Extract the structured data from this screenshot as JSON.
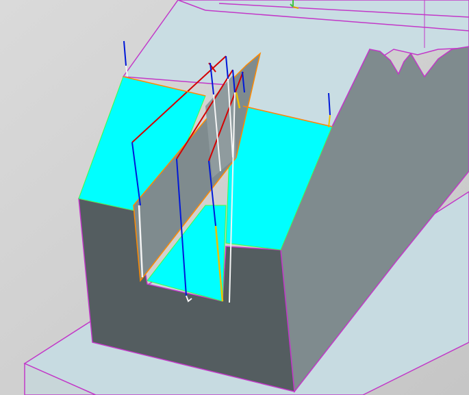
{
  "app": {
    "title": ""
  },
  "viewport": {
    "background_top": "#d8d8d8",
    "background_bottom": "#c4c4c4",
    "label": ""
  },
  "model": {
    "edge_color": "#c238c8",
    "top_face_color": "#c9dde3",
    "side_face_color": "#7f8b8e",
    "dark_face_color": "#545d60",
    "highlight_face_color": "#00ffff",
    "toolpath_colors": {
      "red": "#d40000",
      "blue": "#0018d8",
      "yellow": "#f0c000",
      "orange": "#ff8a00",
      "white": "#f5f5f5",
      "green": "#40ff40"
    }
  },
  "icons": {
    "wcs": "triad-icon"
  }
}
